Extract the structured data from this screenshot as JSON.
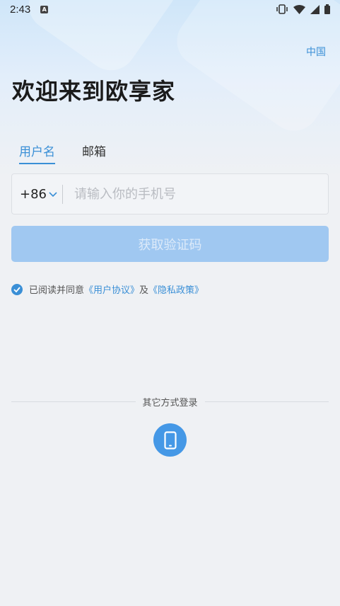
{
  "status_bar": {
    "time": "2:43",
    "notification_icon": "a-icon",
    "icons": [
      "vibrate-icon",
      "wifi-icon",
      "signal-icon",
      "battery-icon"
    ]
  },
  "header": {
    "region": "中国",
    "title": "欢迎来到欧享家"
  },
  "tabs": [
    {
      "label": "用户名",
      "active": true
    },
    {
      "label": "邮箱",
      "active": false
    }
  ],
  "phone_form": {
    "country_code": "+86",
    "placeholder": "请输入你的手机号",
    "value": ""
  },
  "get_code_button": "获取验证码",
  "agreement": {
    "checked": true,
    "prefix": "已阅读并同意",
    "user_agreement": "《用户协议》",
    "conjunction": "及",
    "privacy_policy": "《隐私政策》"
  },
  "other_login": {
    "label": "其它方式登录",
    "methods": [
      "phone-icon"
    ]
  },
  "colors": {
    "accent": "#3a8fd6",
    "button_disabled": "#a0c8f1",
    "background": "#eff1f4"
  }
}
